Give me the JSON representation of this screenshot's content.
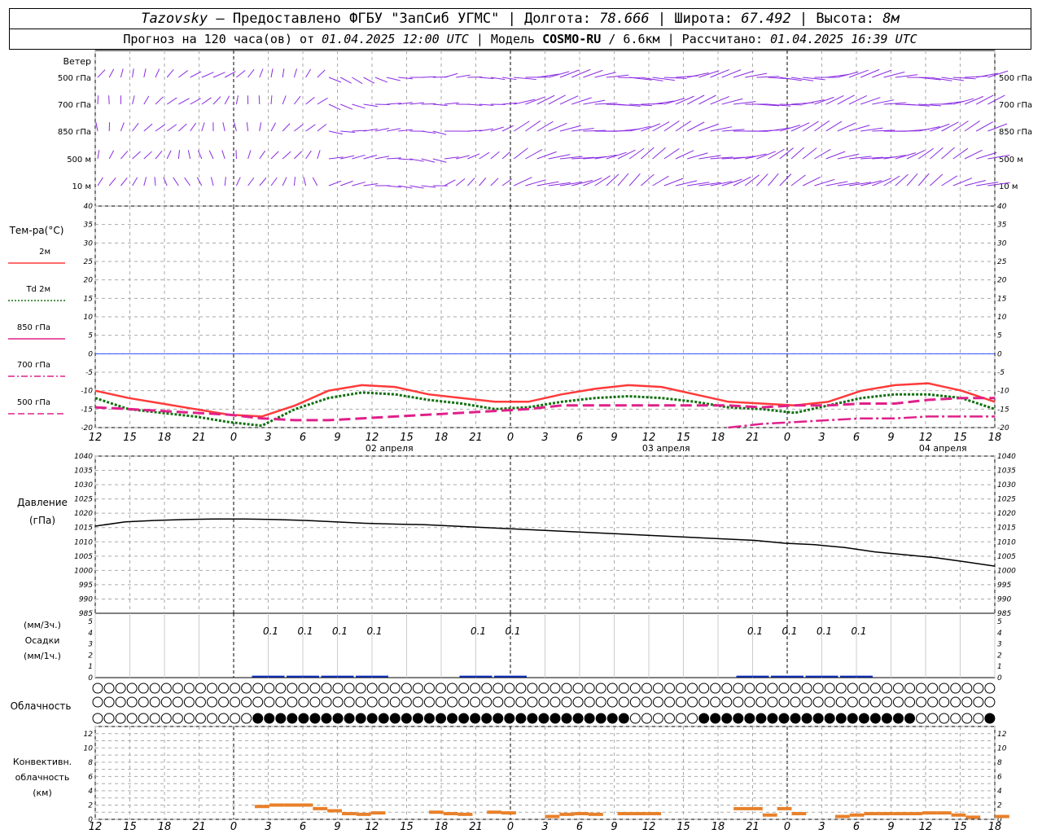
{
  "header": {
    "station": "Tazovsky",
    "provider": "— Предоставлено ФГБУ \"ЗапСиб УГМС\" |",
    "lon_label": "Долгота:",
    "lon": "78.666",
    "lat_label": "| Широта:",
    "lat": "67.492",
    "alt_label": "| Высота:",
    "alt": "8м",
    "forecast_label": "Прогноз на 120 часа(ов) от",
    "forecast_from": "01.04.2025 12:00 UTC",
    "model_label": "| Модель",
    "model": "COSMO-RU",
    "resolution": "/ 6.6км",
    "calc_label": "| Рассчитано:",
    "calc_time": "01.04.2025 16:39 UTC"
  },
  "wind_panel": {
    "title": "Ветер",
    "levels": [
      "500 гПа",
      "700 гПа",
      "850 гПа",
      "500 м",
      "10 м"
    ]
  },
  "temp_panel": {
    "title": "Тем-ра(°C)",
    "legend": [
      {
        "label": "2м",
        "color": "#ff3a3a",
        "style": "solid"
      },
      {
        "label": "Td 2м",
        "color": "#107010",
        "style": "dotted"
      },
      {
        "label": "850 гПа",
        "color": "#e0208a",
        "style": "solid"
      },
      {
        "label": "700 гПа",
        "color": "#e0208a",
        "style": "dashdot"
      },
      {
        "label": "500 гПа",
        "color": "#e0208a",
        "style": "dashed"
      }
    ]
  },
  "x_axis": {
    "ticks": [
      "12",
      "15",
      "18",
      "21",
      "0",
      "3",
      "6",
      "9",
      "12",
      "15",
      "18",
      "21",
      "0",
      "3",
      "6",
      "9",
      "12",
      "15",
      "18",
      "21",
      "0",
      "3",
      "6",
      "9",
      "12",
      "15",
      "18"
    ],
    "dates": [
      "02 апреля",
      "03 апреля",
      "04 апреля"
    ]
  },
  "pressure_panel": {
    "title": "Давление",
    "unit": "(гПа)"
  },
  "precip_panel": {
    "unit1": "(мм/3ч.)",
    "title": "Осадки",
    "unit2": "(мм/1ч.)",
    "labels": [
      "0.1",
      "0.1",
      "0.1",
      "0.1",
      "0.1",
      "0.1",
      "0.1",
      "0.1",
      "0.1",
      "0.1"
    ]
  },
  "cloud_panel": {
    "title": "Облачность"
  },
  "conv_panel": {
    "title1": "Конвективн.",
    "title2": "облачность",
    "unit": "(км)"
  },
  "chart_data": [
    {
      "type": "line",
      "title": "Тем-ра(°C)",
      "x": [
        0,
        3,
        6,
        9,
        12,
        15,
        18,
        21,
        24,
        27,
        30,
        33,
        36,
        39,
        42,
        45,
        48,
        51,
        54,
        57,
        60,
        63,
        66,
        69,
        72,
        75,
        78
      ],
      "ylim": [
        -20,
        40
      ],
      "series": [
        {
          "name": "2м",
          "values": [
            -10,
            -12,
            -13.5,
            -15,
            -16.5,
            -17,
            -14,
            -10,
            -8.5,
            -9,
            -11,
            -12,
            -13,
            -13,
            -11,
            -9.5,
            -8.5,
            -9,
            -11,
            -13,
            -13.5,
            -14,
            -13,
            -10,
            -8.5,
            -8,
            -10,
            -13
          ]
        },
        {
          "name": "Td 2м",
          "values": [
            -12,
            -15,
            -16,
            -17,
            -18.5,
            -19.5,
            -15,
            -12,
            -10.5,
            -11,
            -12.5,
            -13.5,
            -15,
            -14.5,
            -13,
            -12,
            -11.5,
            -12,
            -13,
            -14.5,
            -15,
            -16,
            -14,
            -12,
            -11,
            -11,
            -12,
            -15
          ]
        },
        {
          "name": "850 гПа",
          "values": [
            -14.5,
            -15,
            -15.5,
            -16,
            -16.5,
            -17.5,
            -18,
            -18,
            -17.5,
            -17,
            -16.5,
            -16,
            -15.5,
            -15,
            -14,
            -14,
            -14,
            -14,
            -14,
            -14,
            -14.5,
            -14,
            -14,
            -13.5,
            -13.5,
            -12.5,
            -12,
            -12
          ]
        },
        {
          "name": "700 гПа",
          "values": [
            null,
            null,
            null,
            null,
            null,
            null,
            null,
            null,
            null,
            null,
            null,
            null,
            null,
            null,
            null,
            null,
            null,
            null,
            null,
            -20,
            -19,
            -18.5,
            -18,
            -17.5,
            -17.5,
            -17,
            -17,
            -17
          ]
        },
        {
          "name": "500 гПа",
          "values": [
            null,
            null,
            null,
            null,
            null,
            null,
            null,
            null,
            null,
            null,
            null,
            null,
            null,
            null,
            null,
            null,
            null,
            null,
            null,
            null,
            null,
            null,
            null,
            null,
            null,
            null,
            null,
            null
          ]
        }
      ]
    },
    {
      "type": "line",
      "title": "Давление",
      "ylabel": "(гПа)",
      "ylim": [
        985,
        1040
      ],
      "x": [
        0,
        3,
        6,
        9,
        12,
        15,
        18,
        21,
        24,
        27,
        30,
        33,
        36,
        39,
        42,
        45,
        48,
        51,
        54,
        57,
        60,
        63,
        66,
        69,
        72,
        75,
        78
      ],
      "series": [
        {
          "values": [
            1015.5,
            1017,
            1017.5,
            1017.8,
            1018,
            1018,
            1017.8,
            1017.5,
            1017,
            1016.5,
            1016.2,
            1016,
            1015.5,
            1015,
            1014.5,
            1014,
            1013.5,
            1013,
            1012.5,
            1012,
            1011.5,
            1011,
            1010.5,
            1009.5,
            1009,
            1008,
            1006.5,
            1005.5,
            1004.5,
            1003,
            1001.5
          ]
        }
      ]
    },
    {
      "type": "bar",
      "title": "Осадки",
      "ylim": [
        0,
        5
      ],
      "data_labels": [
        {
          "hour": 15,
          "value": 0.1
        },
        {
          "hour": 18,
          "value": 0.1
        },
        {
          "hour": 21,
          "value": 0.1
        },
        {
          "hour": 24,
          "value": 0.1
        },
        {
          "hour": 33,
          "value": 0.1
        },
        {
          "hour": 36,
          "value": 0.1
        },
        {
          "hour": 57,
          "value": 0.1
        },
        {
          "hour": 60,
          "value": 0.1
        },
        {
          "hour": 63,
          "value": 0.1
        },
        {
          "hour": 66,
          "value": 0.1
        }
      ]
    },
    {
      "type": "bar",
      "title": "Конвективн. облачность",
      "ylabel": "(км)",
      "ylim": [
        0,
        13
      ],
      "values_km": [
        0,
        0,
        0,
        0,
        0,
        0,
        0,
        0,
        0,
        0,
        0,
        1.8,
        2,
        2,
        2,
        1.5,
        1.2,
        0.8,
        0.7,
        0.9,
        0,
        0,
        0,
        1,
        0.8,
        0.7,
        0,
        1,
        0.9,
        0,
        0,
        0.4,
        0.7,
        0.8,
        0.7,
        0,
        0.8,
        0.8,
        0.8,
        0,
        0,
        0,
        0,
        0,
        1.5,
        1.5,
        0.6,
        1.5,
        0.8,
        0,
        0,
        0.4,
        0.6,
        0.8,
        0.8,
        0.8,
        0.8,
        0.9,
        0.9,
        0.6,
        0.3,
        0,
        0.4
      ]
    }
  ]
}
